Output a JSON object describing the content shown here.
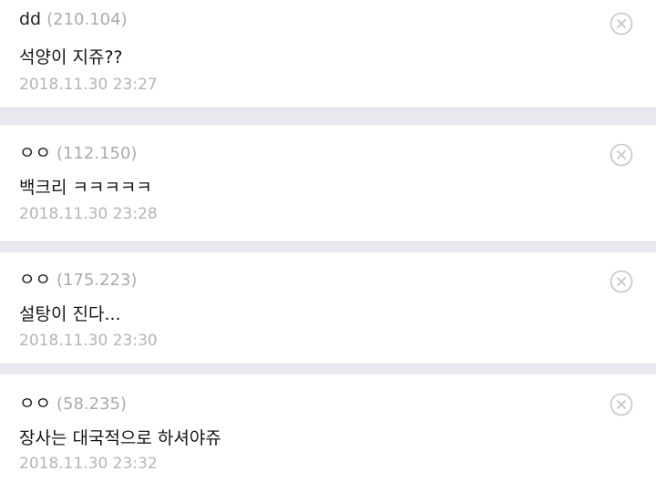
{
  "comments": [
    {
      "author": "dd",
      "ip": "(210.104)",
      "text": "석양이 지쥬??",
      "date": "2018.11.30 23:27"
    },
    {
      "author": "ㅇㅇ",
      "ip": "(112.150)",
      "text": "백크리 ㅋㅋㅋㅋㅋ",
      "date": "2018.11.30 23:28"
    },
    {
      "author": "ㅇㅇ",
      "ip": "(175.223)",
      "text": "설탕이 진다...",
      "date": "2018.11.30 23:30"
    },
    {
      "author": "ㅇㅇ",
      "ip": "(58.235)",
      "text": "장사는 대국적으로 하셔야쥬",
      "date": "2018.11.30 23:32"
    }
  ],
  "icons": {
    "delete": "close-circle-icon"
  },
  "colors": {
    "background": "#ececf2",
    "card": "#ffffff",
    "ip": "#aaaaaa",
    "date": "#b5b5b5",
    "icon": "#c4c4c4"
  }
}
